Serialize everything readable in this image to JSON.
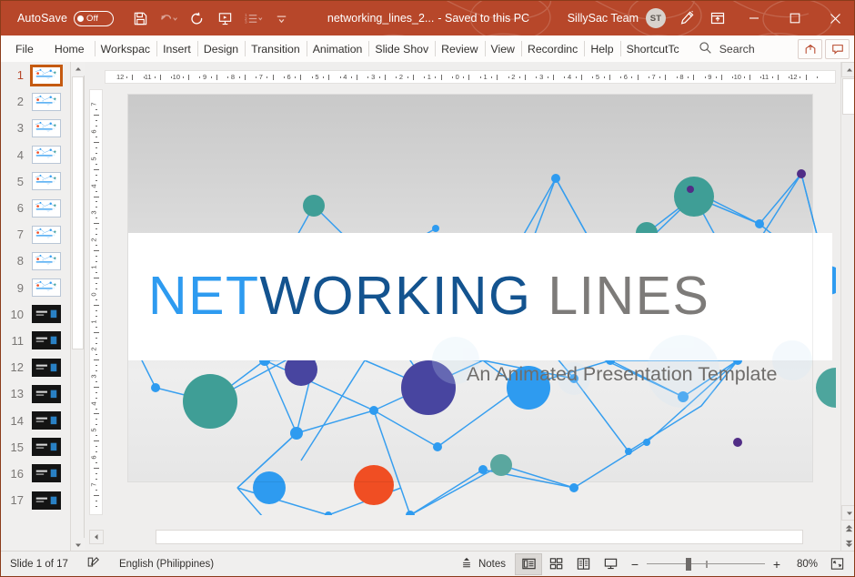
{
  "titlebar": {
    "autosave_label": "AutoSave",
    "autosave_state": "Off",
    "document_name": "networking_lines_2...",
    "save_state": "-  Saved to this PC",
    "account_name": "SillySac Team",
    "account_initials": "ST",
    "accent_color": "#b7472a",
    "qat": [
      {
        "name": "save-icon",
        "label": "Save"
      },
      {
        "name": "undo-icon",
        "label": "Undo"
      },
      {
        "name": "redo-icon",
        "label": "Redo"
      },
      {
        "name": "start-slideshow-icon",
        "label": "Start From Beginning"
      },
      {
        "name": "numbering-icon",
        "label": "Numbering"
      },
      {
        "name": "customize-quick-access-toolbar-icon",
        "label": "Customize Quick Access Toolbar"
      }
    ],
    "window_buttons": [
      "minimize",
      "maximize",
      "close"
    ]
  },
  "ribbon": {
    "tabs": [
      {
        "label": "File"
      },
      {
        "label": "Home"
      },
      {
        "label": "Workspac"
      },
      {
        "label": "Insert"
      },
      {
        "label": "Design"
      },
      {
        "label": "Transition"
      },
      {
        "label": "Animation"
      },
      {
        "label": "Slide Shov"
      },
      {
        "label": "Review"
      },
      {
        "label": "View"
      },
      {
        "label": "Recordinc"
      },
      {
        "label": "Help"
      },
      {
        "label": "ShortcutTc"
      }
    ],
    "search_placeholder": "Search",
    "share_label": "Share",
    "comments_label": "Comments"
  },
  "thumbnails": {
    "selected": 1,
    "items": [
      {
        "number": "1",
        "style": "light"
      },
      {
        "number": "2",
        "style": "light"
      },
      {
        "number": "3",
        "style": "light"
      },
      {
        "number": "4",
        "style": "light"
      },
      {
        "number": "5",
        "style": "light"
      },
      {
        "number": "6",
        "style": "light"
      },
      {
        "number": "7",
        "style": "light"
      },
      {
        "number": "8",
        "style": "light"
      },
      {
        "number": "9",
        "style": "light"
      },
      {
        "number": "10",
        "style": "dark"
      },
      {
        "number": "11",
        "style": "dark"
      },
      {
        "number": "12",
        "style": "dark"
      },
      {
        "number": "13",
        "style": "dark"
      },
      {
        "number": "14",
        "style": "dark"
      },
      {
        "number": "15",
        "style": "dark"
      },
      {
        "number": "16",
        "style": "dark"
      },
      {
        "number": "17",
        "style": "dark"
      }
    ]
  },
  "rulers": {
    "horizontal_ticks": [
      "12",
      "11",
      "10",
      "9",
      "8",
      "7",
      "6",
      "5",
      "4",
      "3",
      "2",
      "1",
      "0",
      "1",
      "2",
      "3",
      "4",
      "5",
      "6",
      "7",
      "8",
      "9",
      "10",
      "11",
      "12"
    ],
    "vertical_ticks": [
      "7",
      "6",
      "5",
      "4",
      "3",
      "2",
      "1",
      "0",
      "1",
      "2",
      "3",
      "4",
      "5",
      "6",
      "7"
    ],
    "units": "inches"
  },
  "slide": {
    "title_part1": "NET",
    "title_part2": "WORKING",
    "title_part3": "LINES",
    "title_color1": "#2e9bf0",
    "title_color2": "#13538f",
    "title_color3": "#7d7b79",
    "subtitle": "An Animated Presentation Template",
    "subtitle_color": "#6f6d6b",
    "node_colors": [
      "#2e9bf0",
      "#3f3f9e",
      "#3f9e96",
      "#f04e23",
      "#3b2a7a"
    ]
  },
  "statusbar": {
    "slide_position": "Slide 1 of 17",
    "language": "English (Philippines)",
    "notes_label": "Notes",
    "views": [
      {
        "name": "normal-view",
        "active": true
      },
      {
        "name": "slide-sorter-view",
        "active": false
      },
      {
        "name": "reading-view",
        "active": false
      },
      {
        "name": "slide-show-view",
        "active": false
      }
    ],
    "zoom_out": "−",
    "zoom_in": "+",
    "zoom_level": "80%",
    "fit_label": "Fit slide to current window"
  }
}
